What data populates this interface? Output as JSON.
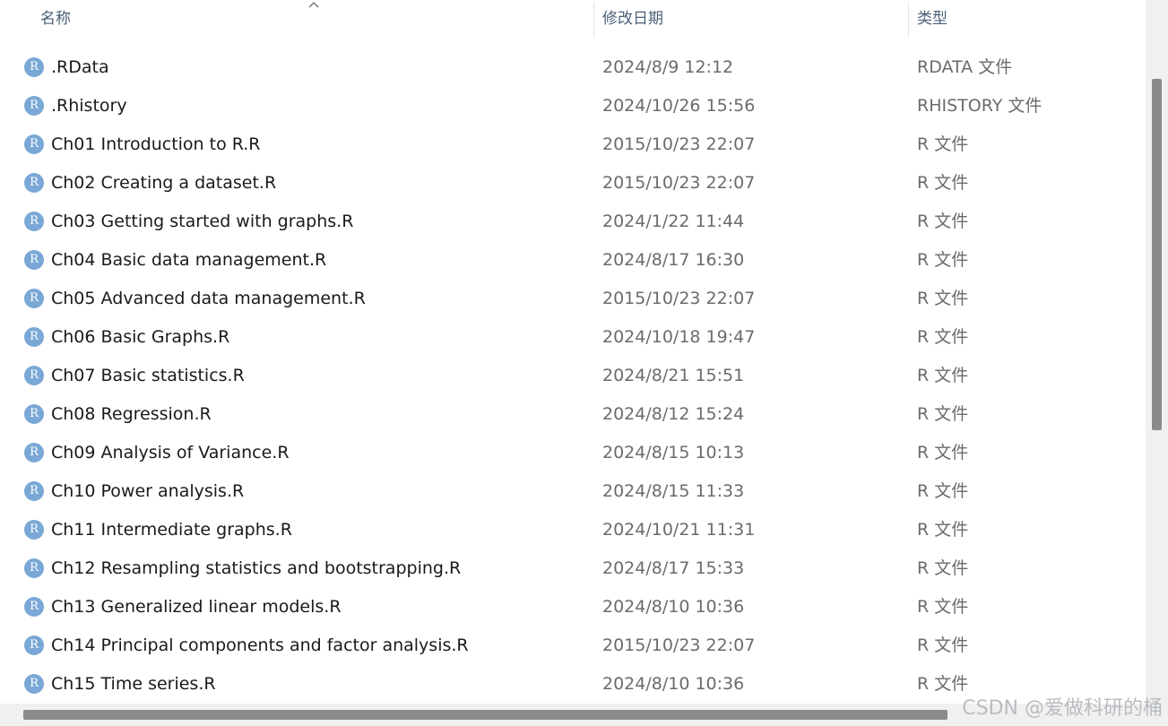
{
  "header": {
    "name_label": "名称",
    "date_label": "修改日期",
    "type_label": "类型"
  },
  "icons": {
    "sort": "chevron-up-icon",
    "file": "r-file-icon",
    "file_letter": "R",
    "file_color": "#7aa8d6"
  },
  "files": [
    {
      "name": ".RData",
      "date": "2024/8/9 12:12",
      "type": "RDATA 文件"
    },
    {
      "name": ".Rhistory",
      "date": "2024/10/26 15:56",
      "type": "RHISTORY 文件"
    },
    {
      "name": "Ch01 Introduction to R.R",
      "date": "2015/10/23 22:07",
      "type": "R 文件"
    },
    {
      "name": "Ch02 Creating a dataset.R",
      "date": "2015/10/23 22:07",
      "type": "R 文件"
    },
    {
      "name": "Ch03 Getting started with graphs.R",
      "date": "2024/1/22 11:44",
      "type": "R 文件"
    },
    {
      "name": "Ch04 Basic data management.R",
      "date": "2024/8/17 16:30",
      "type": "R 文件"
    },
    {
      "name": "Ch05 Advanced data management.R",
      "date": "2015/10/23 22:07",
      "type": "R 文件"
    },
    {
      "name": "Ch06 Basic Graphs.R",
      "date": "2024/10/18 19:47",
      "type": "R 文件"
    },
    {
      "name": "Ch07 Basic statistics.R",
      "date": "2024/8/21 15:51",
      "type": "R 文件"
    },
    {
      "name": "Ch08 Regression.R",
      "date": "2024/8/12 15:24",
      "type": "R 文件"
    },
    {
      "name": "Ch09 Analysis of Variance.R",
      "date": "2024/8/15 10:13",
      "type": "R 文件"
    },
    {
      "name": "Ch10 Power analysis.R",
      "date": "2024/8/15 11:33",
      "type": "R 文件"
    },
    {
      "name": "Ch11 Intermediate graphs.R",
      "date": "2024/10/21 11:31",
      "type": "R 文件"
    },
    {
      "name": "Ch12 Resampling statistics and bootstrapping.R",
      "date": "2024/8/17 15:33",
      "type": "R 文件"
    },
    {
      "name": "Ch13 Generalized linear models.R",
      "date": "2024/8/10 10:36",
      "type": "R 文件"
    },
    {
      "name": "Ch14 Principal components and factor analysis.R",
      "date": "2015/10/23 22:07",
      "type": "R 文件"
    },
    {
      "name": "Ch15 Time series.R",
      "date": "2024/8/10 10:36",
      "type": "R 文件"
    }
  ],
  "watermark": "CSDN @爱做科研的桶"
}
